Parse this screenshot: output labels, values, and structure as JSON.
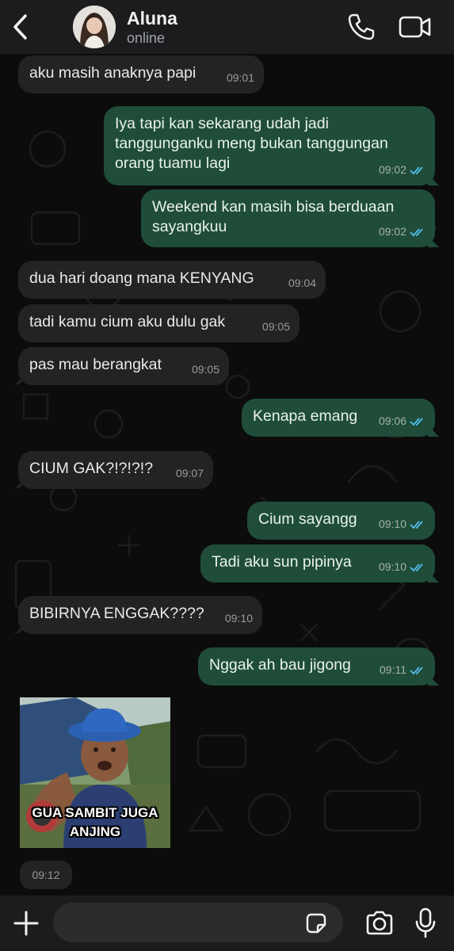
{
  "header": {
    "contact_name": "Aluna",
    "status": "online",
    "back_icon": "chevron-left-icon",
    "call_icon": "phone-icon",
    "video_icon": "video-camera-icon"
  },
  "messages": [
    {
      "dir": "in",
      "text": "aku masih anaknya papi",
      "time": "09:01"
    },
    {
      "dir": "out",
      "text": "Iya tapi kan sekarang udah jadi tanggunganku meng bukan tanggungan orang tuamu lagi",
      "time": "09:02",
      "read": true
    },
    {
      "dir": "out",
      "text": "Weekend kan masih bisa berduaan sayangkuu",
      "time": "09:02",
      "read": true
    },
    {
      "dir": "in",
      "text": "dua hari doang mana KENYANG",
      "time": "09:04"
    },
    {
      "dir": "in",
      "text": "tadi kamu cium aku dulu gak",
      "time": "09:05"
    },
    {
      "dir": "in",
      "text": "pas mau berangkat",
      "time": "09:05"
    },
    {
      "dir": "out",
      "text": "Kenapa emang",
      "time": "09:06",
      "read": true
    },
    {
      "dir": "in",
      "text": "CIUM GAK?!?!?!?",
      "time": "09:07"
    },
    {
      "dir": "out",
      "text": "Cium sayangg",
      "time": "09:10",
      "read": true
    },
    {
      "dir": "out",
      "text": "Tadi aku sun pipinya",
      "time": "09:10",
      "read": true
    },
    {
      "dir": "in",
      "text": "BIBIRNYA ENGGAK????",
      "time": "09:10"
    },
    {
      "dir": "out",
      "text": "Nggak ah bau jigong",
      "time": "09:11",
      "read": true
    }
  ],
  "sticker": {
    "caption_line1": "GUA SAMBIT JUGA",
    "caption_line2": "ANJING",
    "time": "09:12"
  },
  "composer": {
    "placeholder": "",
    "plus_icon": "plus-icon",
    "sticker_icon": "sticker-icon",
    "camera_icon": "camera-icon",
    "mic_icon": "microphone-icon"
  },
  "colors": {
    "incoming_bubble": "#232325",
    "outgoing_bubble": "#1f4d3a",
    "read_ticks": "#53bdeb",
    "bar_background": "#1c1c1e"
  }
}
